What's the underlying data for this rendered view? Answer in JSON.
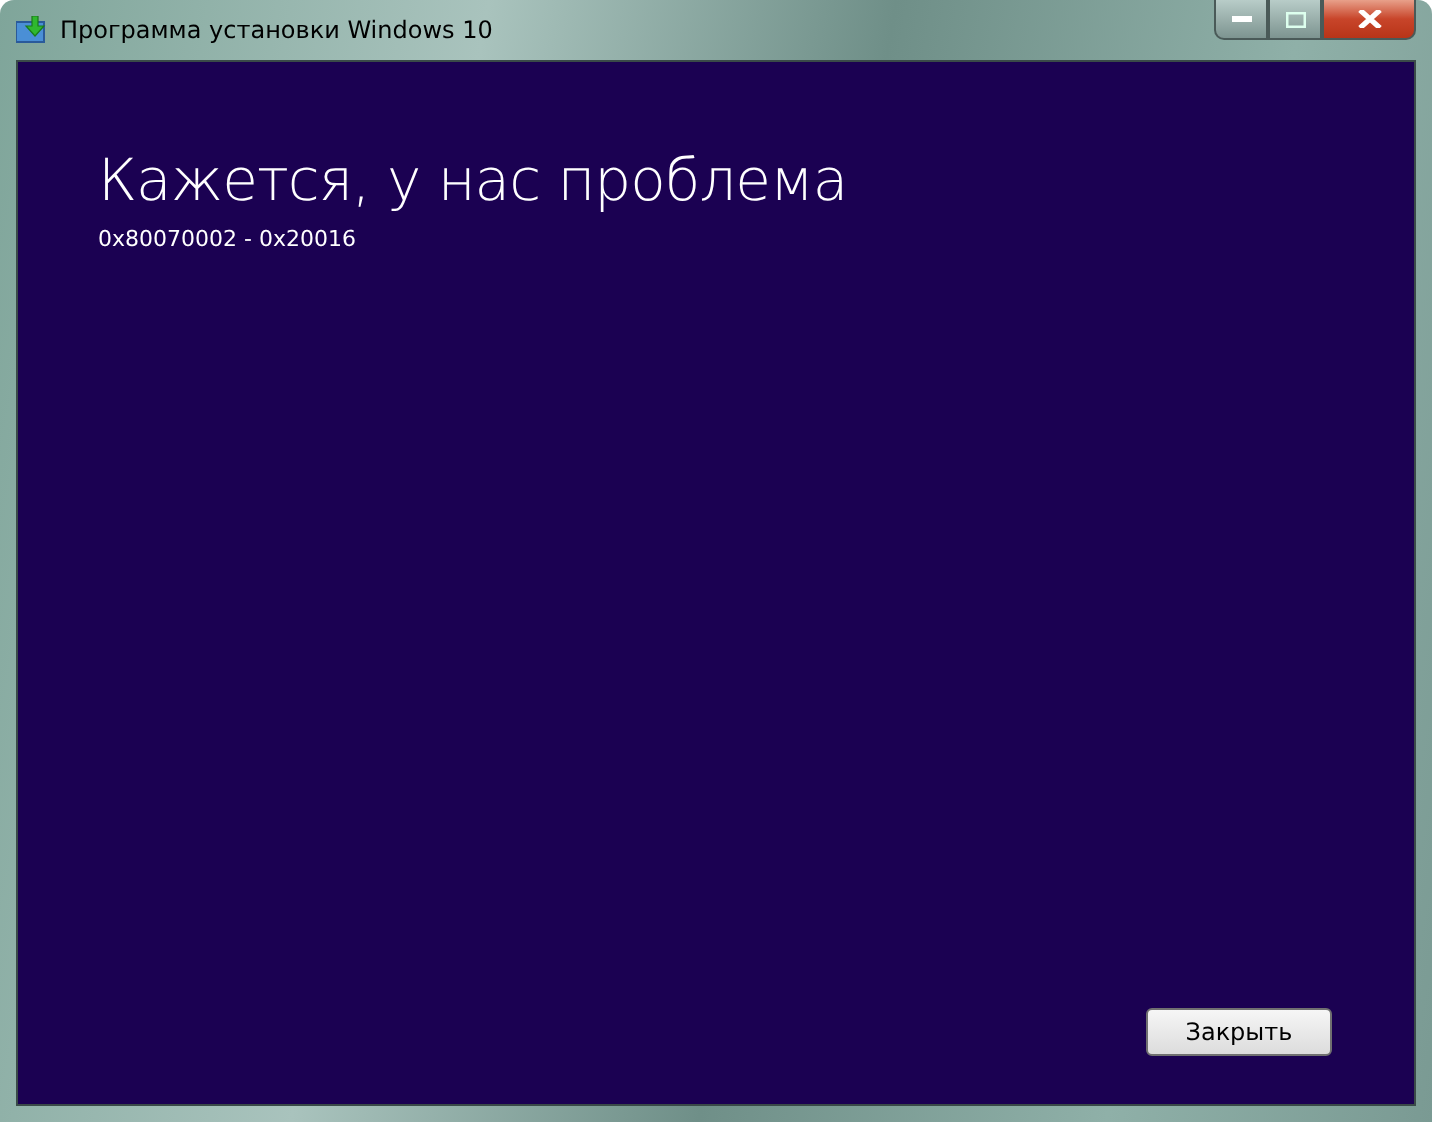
{
  "window": {
    "title": "Программа установки Windows 10"
  },
  "heading": "Кажется, у нас проблема",
  "error_code": "0x80070002 - 0x20016",
  "buttons": [
    "Закрыть"
  ]
}
